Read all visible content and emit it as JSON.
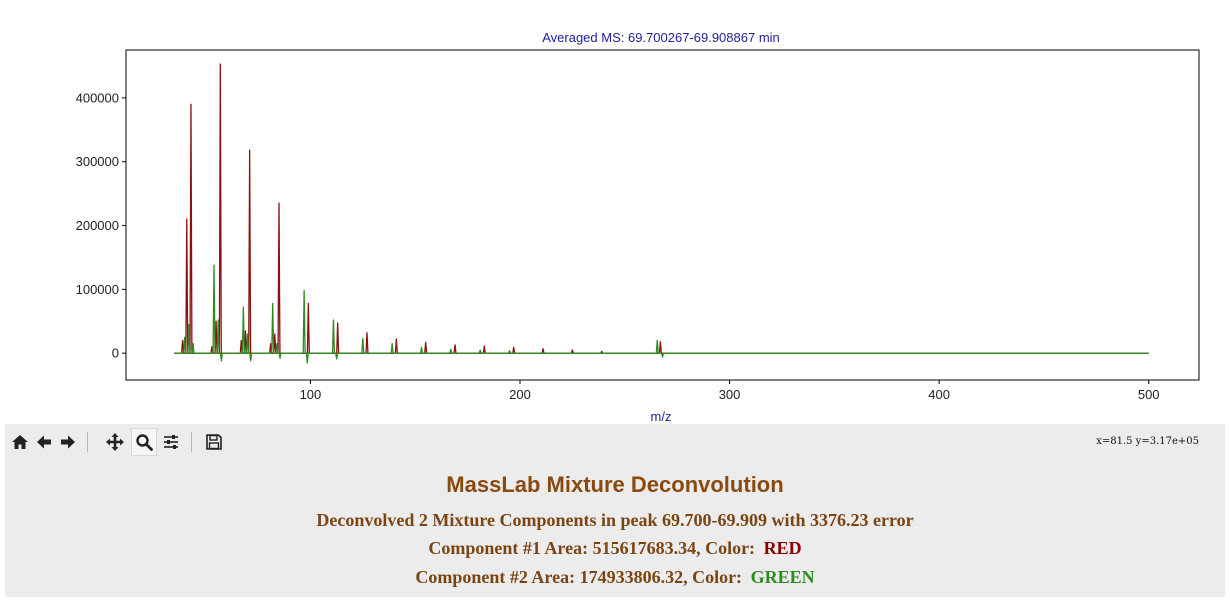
{
  "toolbar": {
    "buttons": [
      {
        "id": "home",
        "icon": "home-icon"
      },
      {
        "id": "back",
        "icon": "arrow-left-icon"
      },
      {
        "id": "forward",
        "icon": "arrow-right-icon"
      },
      {
        "id": "pan",
        "icon": "move-icon"
      },
      {
        "id": "zoom",
        "icon": "magnifier-icon",
        "active": true
      },
      {
        "id": "configure",
        "icon": "sliders-icon"
      },
      {
        "id": "save",
        "icon": "floppy-disk-icon"
      }
    ],
    "coords_text": "x=81.5 y=3.17e+05"
  },
  "panel": {
    "title": "MassLab Mixture Deconvolution",
    "summary": "Deconvolved 2 Mixture Components in peak 69.700-69.909 with 3376.23 error",
    "component1_prefix": "Component #1 Area: 515617683.34, Color:",
    "component1_color_name": "RED",
    "component2_prefix": "Component #2 Area: 174933806.32, Color:",
    "component2_color_name": "GREEN",
    "colors": {
      "title": "#8a4a0f",
      "text": "#7a4512",
      "red": "#8b0000",
      "green": "#2e8b22"
    }
  },
  "chart_data": {
    "type": "line",
    "title": "Averaged MS: 69.700267-69.908867 min",
    "xlabel": "m/z",
    "ylabel": "",
    "xlim": [
      12,
      524
    ],
    "ylim": [
      -42000,
      475000
    ],
    "x_ticks": [
      100,
      200,
      300,
      400,
      500
    ],
    "y_ticks": [
      0,
      100000,
      200000,
      300000,
      400000
    ],
    "x_tick_labels": [
      "100",
      "200",
      "300",
      "400",
      "500"
    ],
    "y_tick_labels": [
      "0",
      "100000",
      "200000",
      "300000",
      "400000"
    ],
    "grid": false,
    "x_range": [
      35,
      500
    ],
    "series": [
      {
        "color": "#8b1010",
        "peaks": [
          {
            "x": 39,
            "y": 20000
          },
          {
            "x": 41,
            "y": 210000
          },
          {
            "x": 43,
            "y": 390000
          },
          {
            "x": 53,
            "y": 10000
          },
          {
            "x": 55,
            "y": 50000
          },
          {
            "x": 57,
            "y": 453000
          },
          {
            "x": 67,
            "y": 20000
          },
          {
            "x": 69,
            "y": 35000
          },
          {
            "x": 71,
            "y": 318000
          },
          {
            "x": 81,
            "y": 15000
          },
          {
            "x": 83,
            "y": 30000
          },
          {
            "x": 85,
            "y": 235000
          },
          {
            "x": 99,
            "y": 78000
          },
          {
            "x": 113,
            "y": 47000
          },
          {
            "x": 127,
            "y": 32000
          },
          {
            "x": 141,
            "y": 22000
          },
          {
            "x": 155,
            "y": 17000
          },
          {
            "x": 169,
            "y": 13000
          },
          {
            "x": 183,
            "y": 11000
          },
          {
            "x": 197,
            "y": 9000
          },
          {
            "x": 211,
            "y": 7000
          },
          {
            "x": 225,
            "y": 5000
          },
          {
            "x": 239,
            "y": 3000
          },
          {
            "x": 267,
            "y": 18000
          }
        ]
      },
      {
        "color": "#2e8b22",
        "peaks": [
          {
            "x": 40,
            "y": 25000
          },
          {
            "x": 42,
            "y": 45000
          },
          {
            "x": 44,
            "y": 15000
          },
          {
            "x": 54,
            "y": 138000
          },
          {
            "x": 56,
            "y": 52000
          },
          {
            "x": 57.5,
            "y": -12000
          },
          {
            "x": 68,
            "y": 72000
          },
          {
            "x": 70,
            "y": 30000
          },
          {
            "x": 71.5,
            "y": -12000
          },
          {
            "x": 82,
            "y": 78000
          },
          {
            "x": 84,
            "y": 15000
          },
          {
            "x": 85.5,
            "y": -8000
          },
          {
            "x": 97,
            "y": 98000
          },
          {
            "x": 98.5,
            "y": -15000
          },
          {
            "x": 111,
            "y": 52000
          },
          {
            "x": 112.5,
            "y": -9000
          },
          {
            "x": 125,
            "y": 23000
          },
          {
            "x": 139,
            "y": 15000
          },
          {
            "x": 153,
            "y": 9000
          },
          {
            "x": 167,
            "y": 6000
          },
          {
            "x": 181,
            "y": 5000
          },
          {
            "x": 195,
            "y": 4000
          },
          {
            "x": 265.5,
            "y": 20000
          },
          {
            "x": 268,
            "y": -6000
          }
        ]
      }
    ]
  }
}
